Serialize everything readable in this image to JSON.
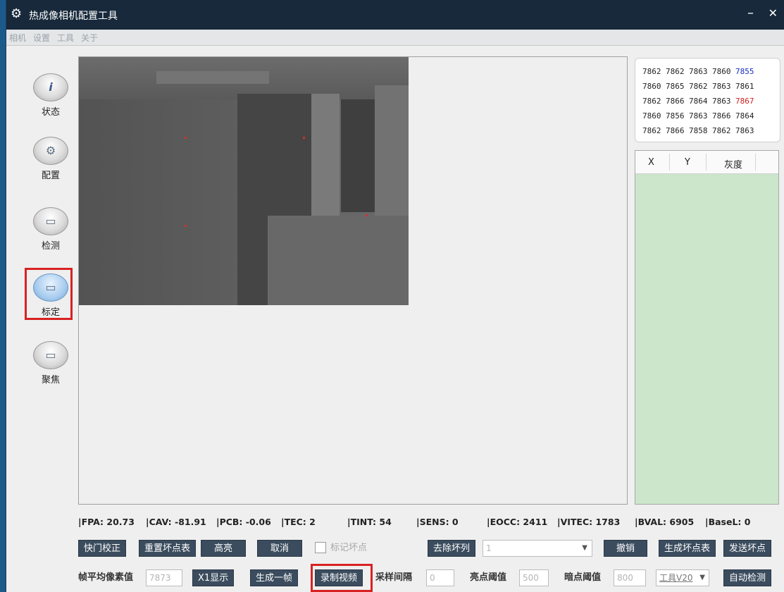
{
  "window": {
    "title": "热成像相机配置工具",
    "menu": [
      "相机",
      "设置",
      "工具",
      "关于"
    ]
  },
  "sidebar": {
    "items": [
      {
        "label": "状态",
        "icon": "info-icon"
      },
      {
        "label": "配置",
        "icon": "gear-icon"
      },
      {
        "label": "检测",
        "icon": "monitor-icon"
      },
      {
        "label": "标定",
        "icon": "screen-icon",
        "active": true
      },
      {
        "label": "聚焦",
        "icon": "screen-icon"
      }
    ]
  },
  "pixel_grid": {
    "rows": [
      [
        "7862",
        "7862",
        "7863",
        "7860",
        "7855"
      ],
      [
        "7860",
        "7865",
        "7862",
        "7863",
        "7861"
      ],
      [
        "7862",
        "7866",
        "7864",
        "7863",
        "7867"
      ],
      [
        "7860",
        "7856",
        "7863",
        "7866",
        "7864"
      ],
      [
        "7862",
        "7866",
        "7858",
        "7862",
        "7863"
      ]
    ],
    "highlight": {
      "blue": "7855",
      "red": "7867"
    }
  },
  "dead_pixel_table": {
    "columns": [
      "X",
      "Y",
      "灰度"
    ]
  },
  "status": {
    "fpa": "|FPA: 20.73",
    "cav": "|CAV: -81.91",
    "pcb": "|PCB: -0.06",
    "tec": "|TEC: 2",
    "tint": "|TINT: 54",
    "sens": "|SENS: 0",
    "eocc": "|EOCC: 2411",
    "vitec": "|VITEC: 1783",
    "bval": "|BVAL: 6905",
    "basel": "|BaseL: 0"
  },
  "row1": {
    "shutter": "快门校正",
    "reset_table": "重置坏点表",
    "highlight": "高亮",
    "cancel": "取消",
    "mark_label": "标记坏点",
    "remove_col": "去除坏列",
    "col_select": "1",
    "undo": "撤销",
    "gen_table": "生成坏点表",
    "send": "发送坏点"
  },
  "row2": {
    "avg_label": "帧平均像素值",
    "avg_value": "7873",
    "x1": "X1显示",
    "gen_frame": "生成一帧",
    "record": "录制视频",
    "interval_label": "采样间隔",
    "interval_value": "0",
    "bright_label": "亮点阈值",
    "bright_value": "500",
    "dark_label": "暗点阈值",
    "dark_value": "800",
    "tool_select": "工具V20",
    "auto_detect": "自动检测"
  }
}
